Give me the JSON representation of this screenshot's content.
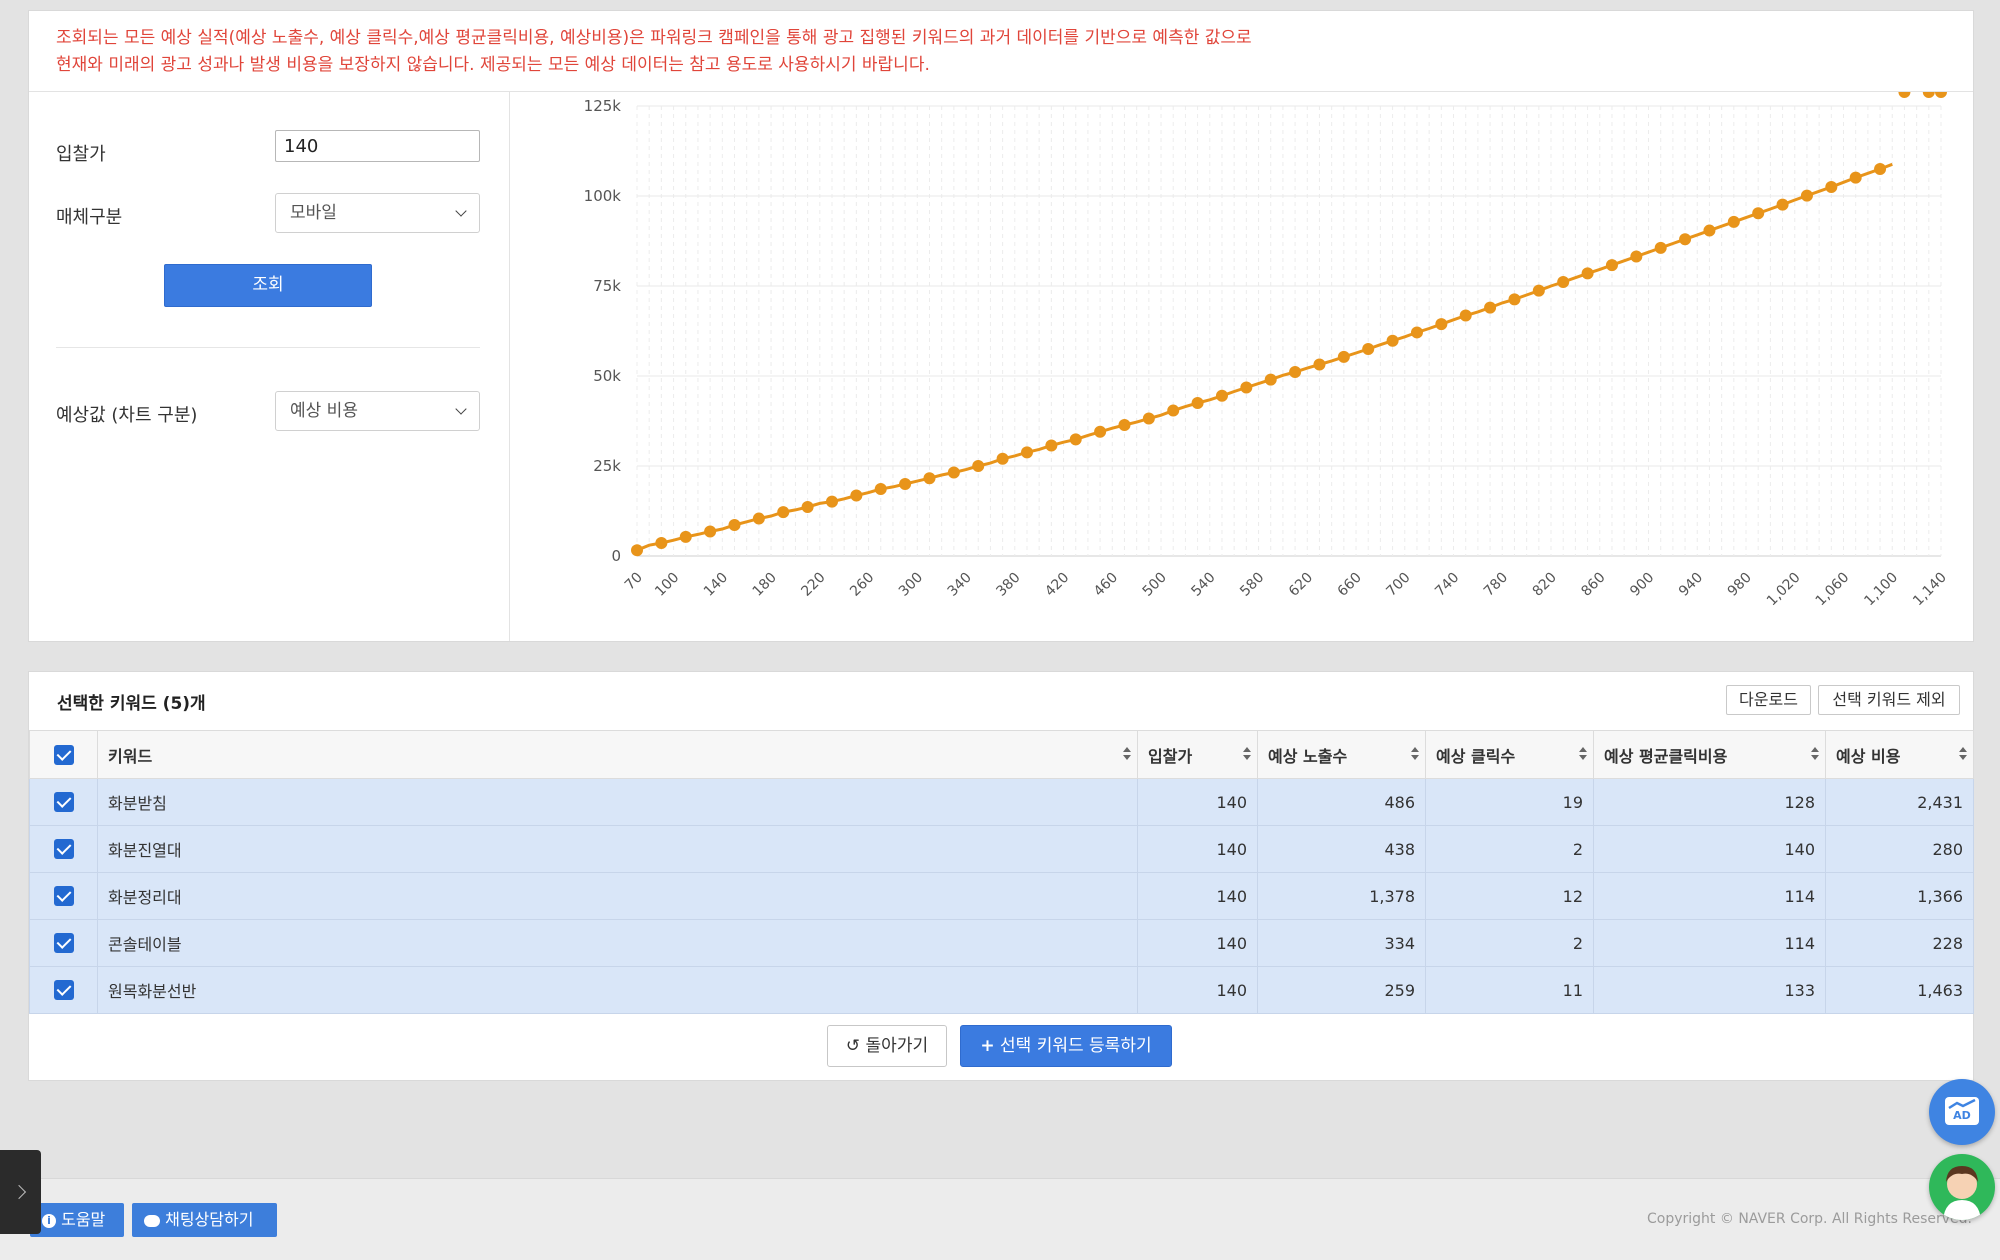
{
  "notice": {
    "line1": "조회되는 모든 예상 실적(예상 노출수, 예상 클릭수,예상 평균클릭비용, 예상비용)은 파워링크 캠페인을 통해 광고 집행된 키워드의 과거 데이터를 기반으로 예측한 값으로",
    "line2": "현재와 미래의 광고 성과나 발생 비용을 보장하지 않습니다. 제공되는 모든 예상 데이터는 참고 용도로 사용하시기 바랍니다."
  },
  "form": {
    "bid_label": "입찰가",
    "bid_value": "140",
    "media_label": "매체구분",
    "media_value": "모바일",
    "search_button": "조회",
    "metric_label": "예상값 (차트 구분)",
    "metric_value": "예상 비용"
  },
  "chart_data": {
    "type": "line",
    "color": "#e8941a",
    "ylim": [
      0,
      125000
    ],
    "yticks": [
      "0",
      "25k",
      "50k",
      "75k",
      "100k",
      "125k"
    ],
    "x": [
      70,
      80,
      90,
      100,
      110,
      120,
      130,
      140,
      150,
      160,
      170,
      180,
      190,
      200,
      210,
      220,
      230,
      240,
      250,
      260,
      270,
      280,
      290,
      300,
      310,
      320,
      330,
      340,
      350,
      360,
      370,
      380,
      390,
      400,
      410,
      420,
      430,
      440,
      450,
      460,
      470,
      480,
      490,
      500,
      510,
      520,
      530,
      540,
      550,
      560,
      570,
      580,
      590,
      600,
      610,
      620,
      630,
      640,
      650,
      660,
      670,
      680,
      690,
      700,
      710,
      720,
      730,
      740,
      750,
      760,
      770,
      780,
      790,
      800,
      810,
      820,
      830,
      840,
      850,
      860,
      870,
      880,
      890,
      900,
      910,
      920,
      930,
      940,
      950,
      960,
      970,
      980,
      990,
      1000,
      1010,
      1020,
      1030,
      1040,
      1050,
      1060,
      1070,
      1080,
      1090,
      1100,
      1110,
      1120,
      1130,
      1140
    ],
    "xtick_labels": [
      "70",
      "100",
      "140",
      "180",
      "220",
      "260",
      "300",
      "340",
      "380",
      "420",
      "460",
      "500",
      "540",
      "580",
      "620",
      "660",
      "700",
      "740",
      "780",
      "820",
      "860",
      "900",
      "940",
      "980",
      "1,020",
      "1,060",
      "1,100",
      "1,140"
    ],
    "values": [
      1600,
      3000,
      3600,
      4400,
      5300,
      6000,
      6800,
      7500,
      8600,
      9500,
      10400,
      11100,
      12200,
      12800,
      13600,
      14600,
      15100,
      15900,
      16800,
      17600,
      18600,
      19200,
      20000,
      20800,
      21600,
      22500,
      23200,
      24000,
      25000,
      25800,
      27000,
      27800,
      28800,
      29600,
      30700,
      31600,
      32400,
      33500,
      34500,
      35500,
      36400,
      37200,
      38200,
      39100,
      40400,
      41500,
      42500,
      43400,
      44500,
      45700,
      46800,
      47900,
      49000,
      50200,
      51100,
      52200,
      53200,
      54200,
      55300,
      56400,
      57500,
      58700,
      59800,
      60900,
      62100,
      63200,
      64400,
      65600,
      66800,
      67800,
      69000,
      70300,
      71300,
      72500,
      73700,
      75000,
      76100,
      77300,
      78500,
      79600,
      80800,
      82000,
      83200,
      84400,
      85600,
      86800,
      88000,
      89200,
      90400,
      91600,
      92800,
      94000,
      95200,
      96400,
      97600,
      98900,
      100100,
      101300,
      102500,
      103800,
      105100,
      106300,
      107500,
      108800
    ]
  },
  "table": {
    "title": "선택한 키워드 (5)개",
    "download_button": "다운로드",
    "exclude_button": "선택 키워드 제외",
    "columns": [
      "키워드",
      "입찰가",
      "예상 노출수",
      "예상 클릭수",
      "예상 평균클릭비용",
      "예상 비용"
    ],
    "rows": [
      {
        "keyword": "화분받침",
        "bid": "140",
        "impressions": "486",
        "clicks": "19",
        "cpc": "128",
        "cost": "2,431"
      },
      {
        "keyword": "화분진열대",
        "bid": "140",
        "impressions": "438",
        "clicks": "2",
        "cpc": "140",
        "cost": "280"
      },
      {
        "keyword": "화분정리대",
        "bid": "140",
        "impressions": "1,378",
        "clicks": "12",
        "cpc": "114",
        "cost": "1,366"
      },
      {
        "keyword": "콘솔테이블",
        "bid": "140",
        "impressions": "334",
        "clicks": "2",
        "cpc": "114",
        "cost": "228"
      },
      {
        "keyword": "원목화분선반",
        "bid": "140",
        "impressions": "259",
        "clicks": "11",
        "cpc": "133",
        "cost": "1,463"
      }
    ],
    "back_button": "돌아가기",
    "register_button": "선택 키워드 등록하기"
  },
  "footer": {
    "help_button": "도움말",
    "chat_button": "채팅상담하기",
    "copyright": "Copyright © NAVER Corp. All Rights Reserved.",
    "ad_badge": "AD"
  }
}
